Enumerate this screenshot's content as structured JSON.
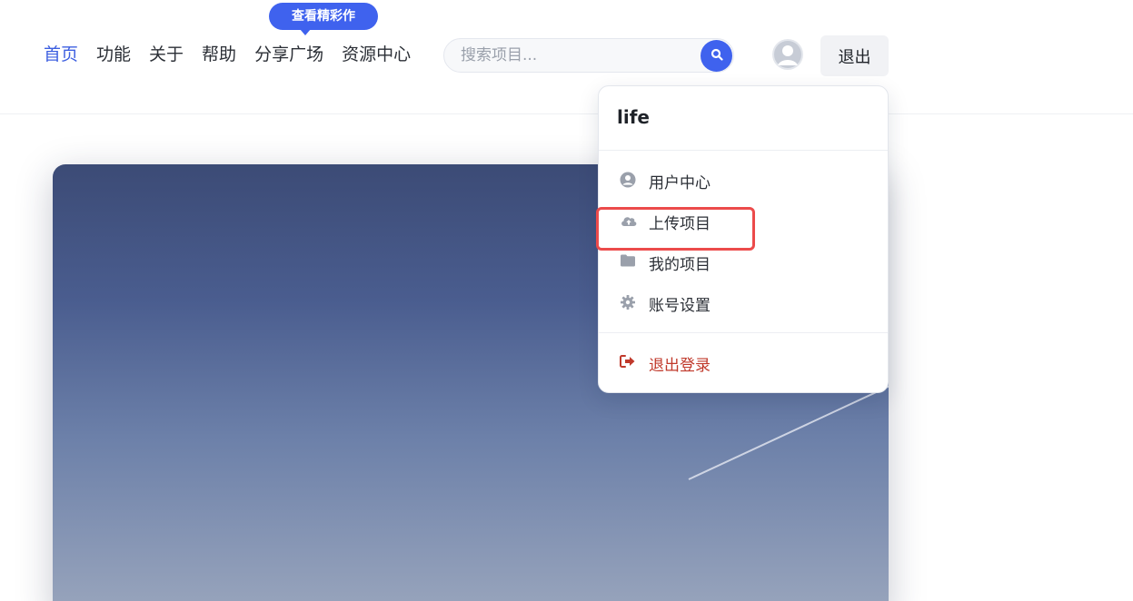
{
  "nav": {
    "items": [
      {
        "label": "首页",
        "active": true
      },
      {
        "label": "功能"
      },
      {
        "label": "关于"
      },
      {
        "label": "帮助"
      },
      {
        "label": "分享广场"
      },
      {
        "label": "资源中心"
      }
    ],
    "tooltip": "查看精彩作"
  },
  "search": {
    "placeholder": "搜索项目...",
    "value": ""
  },
  "header": {
    "logout_label": "退出"
  },
  "user_menu": {
    "username": "life",
    "items": [
      {
        "label": "用户中心",
        "icon": "user-circle-icon"
      },
      {
        "label": "上传项目",
        "icon": "cloud-upload-icon"
      },
      {
        "label": "我的项目",
        "icon": "folder-icon"
      },
      {
        "label": "账号设置",
        "icon": "gear-icon"
      }
    ],
    "logout": {
      "label": "退出登录",
      "icon": "sign-out-icon"
    }
  },
  "colors": {
    "accent": "#3f62ee",
    "danger": "#c0392b",
    "highlight": "#ec4b4b"
  }
}
